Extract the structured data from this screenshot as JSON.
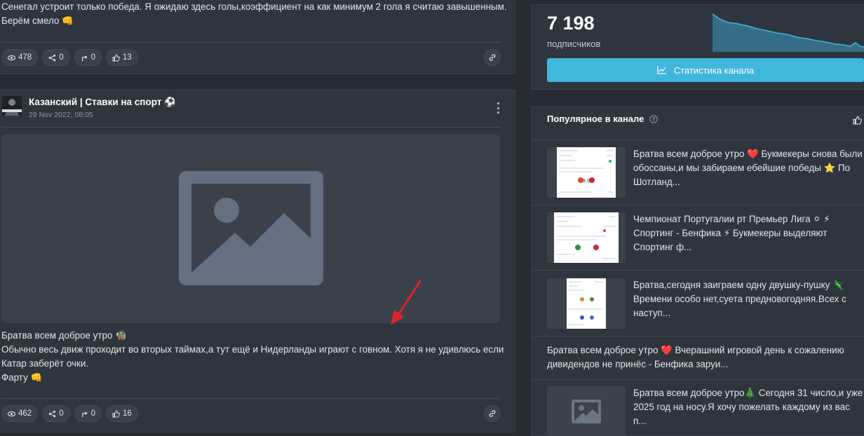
{
  "post_prev": {
    "lines": [
      "Сенегал устроит только победа. Я ожидаю здесь голы,коэффициент на как минимум 2 гола я считаю завышенным.",
      "Берём смело 👊"
    ],
    "stats": {
      "views": "478",
      "shares": "0",
      "forwards": "0",
      "likes": "13"
    }
  },
  "post": {
    "channel_name": "Казанский | Ставки на спорт ⚽",
    "date": "29 Nov 2022, 08:05",
    "lines": [
      "Братва всем доброе утро 🧌",
      "Обычно весь движ проходит во вторых таймах,а тут ещё и Нидерланды играют с говном. Хотя я не удивлюсь если",
      "Катар заберёт очки.",
      "Фарту 👊"
    ],
    "stats": {
      "views": "462",
      "shares": "0",
      "forwards": "0",
      "likes": "16"
    }
  },
  "channel_stats": {
    "subscriber_count": "7 198",
    "subscriber_label": "подписчиков",
    "button_label": "Статистика канала",
    "accent": "#3fb6dc"
  },
  "popular": {
    "title": "Популярное в канале",
    "items": [
      {
        "lines": [
          "Братва всем доброе утро ❤️ Букмекеры снова были",
          "обоссаны,и мы забираем ебейшие победы ⭐ По",
          "Шотланд..."
        ]
      },
      {
        "lines": [
          "Чемпионат Португалии рт Премьер Лига ⚪ ⚡",
          "Спортинг - Бенфика ⚡ Букмекеры выделяют",
          "Спортинг ф..."
        ]
      },
      {
        "lines": [
          "Братва,сегодня заиграем одну двушку-пушку 🦎",
          "Времени особо нет,суета предновогодняя.Всех с",
          "наступ..."
        ]
      },
      {
        "lines": [
          "Братва всем доброе утро ❤️ Вчерашний игровой день к сожалению",
          "дивидендов не принёс - Бенфика заруи..."
        ]
      },
      {
        "lines": [
          "Братва всем доброе утро🎄 Сегодня 31 число,и уже",
          "2025 год на носу.Я хочу пожелать каждому из вас п..."
        ]
      }
    ]
  }
}
